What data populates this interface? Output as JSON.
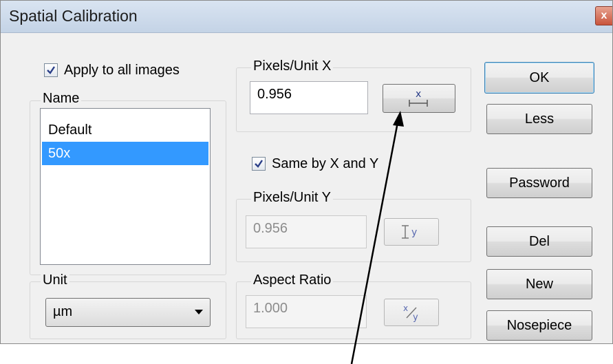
{
  "window": {
    "title": "Spatial Calibration",
    "close_glyph": "x"
  },
  "apply_all": {
    "label": "Apply to all images",
    "checked": true
  },
  "name_group": {
    "label": "Name",
    "items": [
      {
        "label": "Default",
        "selected": false
      },
      {
        "label": "50x",
        "selected": true
      }
    ]
  },
  "unit_group": {
    "label": "Unit",
    "value": "µm"
  },
  "pixels_x": {
    "label": "Pixels/Unit X",
    "value": "0.956"
  },
  "same_xy": {
    "label": "Same by X and Y",
    "checked": true
  },
  "pixels_y": {
    "label": "Pixels/Unit Y",
    "value": "0.956"
  },
  "aspect": {
    "label": "Aspect Ratio",
    "value": "1.000"
  },
  "buttons": {
    "ok": "OK",
    "less": "Less",
    "password": "Password",
    "del": "Del",
    "new": "New",
    "nosepiece": "Nosepiece"
  },
  "icons": {
    "measure_x": "measure-x-icon",
    "measure_y": "measure-y-icon",
    "aspect_xy": "aspect-xy-icon"
  },
  "colors": {
    "selection": "#3399ff",
    "titlebar": "#c4d3e6",
    "dialog_bg": "#f0f0f0"
  }
}
